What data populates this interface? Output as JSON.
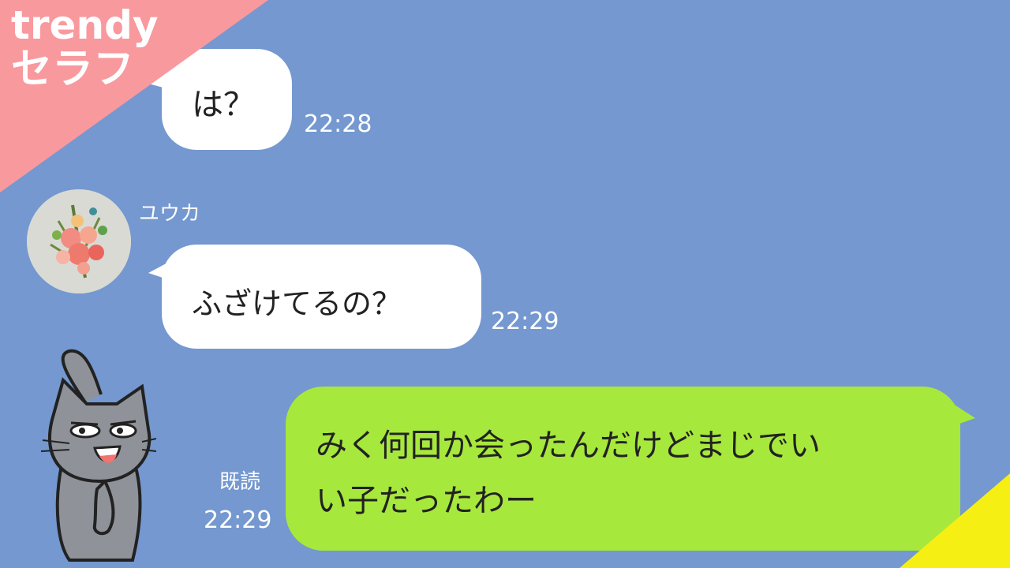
{
  "banner": {
    "line1": "trendy",
    "line2": "セラフ"
  },
  "messages": [
    {
      "text": "は？",
      "time": "22:28"
    },
    {
      "sender": "ユウカ",
      "text": "ふざけてるの？",
      "time": "22:29"
    },
    {
      "read": "既読",
      "time": "22:29",
      "line1": "みく何回か会ったんだけどまじでい",
      "line2": "い子だったわー"
    }
  ],
  "colors": {
    "background": "#7498cf",
    "bubble_white": "#ffffff",
    "bubble_green": "#a7e83c",
    "banner": "#f8999e",
    "corner_accent": "#f6ef14"
  },
  "icons": {
    "avatar": "flower-bouquet-avatar",
    "mascot": "gray-cat-mascot"
  }
}
